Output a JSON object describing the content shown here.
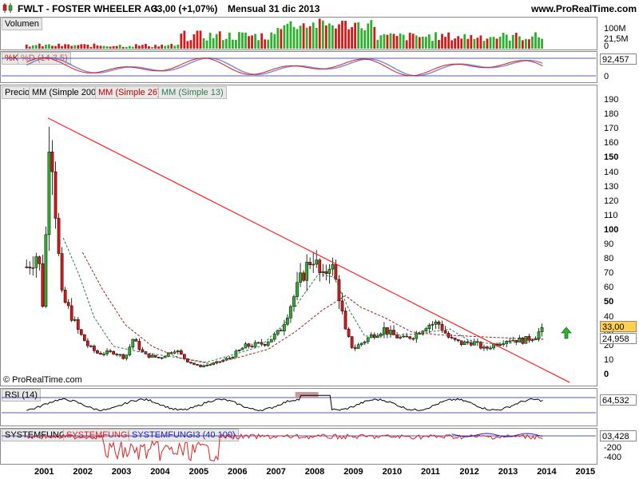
{
  "header": {
    "ticker": "FWLT - FOSTER WHEELER AG.",
    "last": "33,00 (+1,07%)",
    "period": "Mensual  31 dic 2013",
    "site": "www.ProRealTime.com"
  },
  "panels": {
    "volume": {
      "label": "Volumen",
      "ticks": [
        "100M",
        "21,5M",
        "0"
      ]
    },
    "stoch": {
      "label_k": "%K",
      "label_d": "%D (14 3 5)",
      "value": "92,457",
      "ticks": [
        "100",
        "0"
      ]
    },
    "price": {
      "label": "Precio",
      "ma200": "MM (Simple 200)",
      "ma26": "MM (Simple 26)",
      "ma13": "MM (Simple 13)",
      "last_value": "33,00",
      "ma_value": "24,958",
      "copyright": "© ProRealTime.com"
    },
    "rsi": {
      "label": "RSI (14)",
      "value": "64,532"
    },
    "system": {
      "label1": "SYSTEMFUNGI",
      "label2": "SYSTEMFUNGI2",
      "label3": "SYSTEMFUNGI3 (40 100)",
      "value": "03,428",
      "ticks": [
        "-200",
        "-400"
      ]
    }
  },
  "colors": {
    "up": "#2db02d",
    "down": "#d81818",
    "trendline": "#ff2020",
    "ma13": "#2e7d4f",
    "ma26": "#a02020",
    "stoch_k": "#d02020",
    "stoch_d": "#6060c0",
    "rsi_fill": "#c89a9a",
    "sys_red": "#e02020",
    "sys_blue": "#2020c0"
  },
  "chart_data": {
    "type": "candlestick",
    "x_axis": {
      "labels": [
        "2001",
        "2002",
        "2003",
        "2004",
        "2005",
        "2006",
        "2007",
        "2008",
        "2009",
        "2010",
        "2011",
        "2012",
        "2013",
        "2014",
        "2015"
      ]
    },
    "y_axis": {
      "ticks": [
        0,
        10,
        20,
        30,
        40,
        50,
        60,
        70,
        80,
        90,
        100,
        110,
        120,
        130,
        140,
        150,
        160,
        170,
        180,
        190
      ],
      "range": [
        0,
        195
      ]
    },
    "series": [
      {
        "name": "Precio",
        "keypoints": [
          [
            "2000.55",
            75
          ],
          [
            "2000.85",
            85
          ],
          [
            "2001.00",
            40
          ],
          [
            "2001.08",
            130
          ],
          [
            "2001.15",
            180
          ],
          [
            "2001.30",
            115
          ],
          [
            "2001.45",
            55
          ],
          [
            "2001.65",
            45
          ],
          [
            "2001.90",
            30
          ],
          [
            "2002.15",
            20
          ],
          [
            "2002.40",
            15
          ],
          [
            "2002.80",
            16
          ],
          [
            "2003.10",
            12
          ],
          [
            "2003.30",
            25
          ],
          [
            "2003.60",
            14
          ],
          [
            "2004.00",
            12
          ],
          [
            "2004.40",
            18
          ],
          [
            "2004.70",
            10
          ],
          [
            "2005.00",
            6
          ],
          [
            "2005.40",
            8
          ],
          [
            "2005.80",
            12
          ],
          [
            "2006.20",
            20
          ],
          [
            "2006.70",
            22
          ],
          [
            "2007.10",
            30
          ],
          [
            "2007.40",
            50
          ],
          [
            "2007.70",
            70
          ],
          [
            "2007.95",
            83
          ],
          [
            "2008.20",
            65
          ],
          [
            "2008.40",
            80
          ],
          [
            "2008.60",
            60
          ],
          [
            "2008.80",
            30
          ],
          [
            "2009.00",
            18
          ],
          [
            "2009.20",
            22
          ],
          [
            "2009.50",
            28
          ],
          [
            "2009.80",
            32
          ],
          [
            "2010.00",
            28
          ],
          [
            "2010.30",
            25
          ],
          [
            "2010.60",
            28
          ],
          [
            "2010.90",
            35
          ],
          [
            "2011.20",
            36
          ],
          [
            "2011.50",
            25
          ],
          [
            "2011.80",
            22
          ],
          [
            "2012.10",
            23
          ],
          [
            "2012.40",
            18
          ],
          [
            "2012.70",
            22
          ],
          [
            "2013.00",
            25
          ],
          [
            "2013.40",
            24
          ],
          [
            "2013.70",
            27
          ],
          [
            "2013.92",
            33
          ]
        ]
      },
      {
        "name": "MM (Simple 13)",
        "keypoints": [
          [
            "2001.50",
            95
          ],
          [
            "2001.90",
            70
          ],
          [
            "2002.30",
            40
          ],
          [
            "2002.80",
            20
          ],
          [
            "2003.50",
            16
          ],
          [
            "2004.50",
            12
          ],
          [
            "2005.20",
            9
          ],
          [
            "2006.00",
            15
          ],
          [
            "2006.60",
            20
          ],
          [
            "2007.20",
            35
          ],
          [
            "2007.70",
            55
          ],
          [
            "2008.10",
            70
          ],
          [
            "2008.50",
            68
          ],
          [
            "2008.90",
            45
          ],
          [
            "2009.30",
            27
          ],
          [
            "2009.80",
            28
          ],
          [
            "2010.40",
            28
          ],
          [
            "2011.00",
            30
          ],
          [
            "2011.50",
            32
          ],
          [
            "2012.00",
            24
          ],
          [
            "2012.50",
            22
          ],
          [
            "2013.00",
            22
          ],
          [
            "2013.50",
            24
          ],
          [
            "2013.92",
            24.958
          ]
        ]
      },
      {
        "name": "MM (Simple 26)",
        "keypoints": [
          [
            "2002.00",
            85
          ],
          [
            "2002.50",
            60
          ],
          [
            "2003.10",
            35
          ],
          [
            "2003.80",
            20
          ],
          [
            "2004.50",
            12
          ],
          [
            "2005.30",
            8
          ],
          [
            "2006.00",
            12
          ],
          [
            "2006.80",
            18
          ],
          [
            "2007.50",
            30
          ],
          [
            "2008.20",
            45
          ],
          [
            "2008.80",
            55
          ],
          [
            "2009.20",
            47
          ],
          [
            "2009.80",
            40
          ],
          [
            "2010.50",
            30
          ],
          [
            "2011.20",
            28
          ],
          [
            "2012.00",
            27
          ],
          [
            "2012.80",
            26
          ],
          [
            "2013.50",
            25
          ],
          [
            "2013.92",
            25
          ]
        ]
      }
    ]
  }
}
